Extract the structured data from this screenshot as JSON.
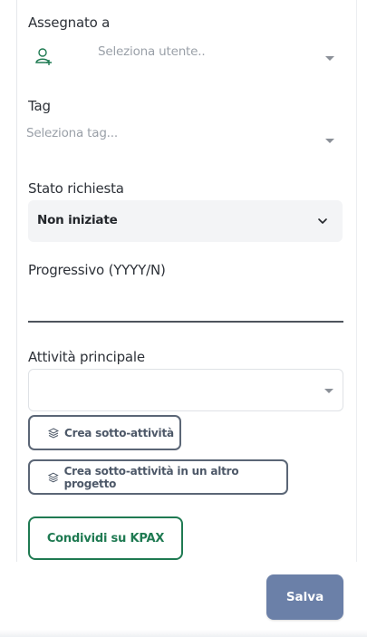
{
  "assigned": {
    "label": "Assegnato a",
    "placeholder": "Seleziona utente..",
    "icon": "add-user-icon"
  },
  "tag": {
    "label": "Tag",
    "placeholder": "Seleziona tag..."
  },
  "status": {
    "label": "Stato richiesta",
    "value": "Non iniziate"
  },
  "progressive": {
    "label": "Progressivo (YYYY/N)",
    "value": ""
  },
  "main_activity": {
    "label": "Attività principale",
    "value": ""
  },
  "buttons": {
    "create_subtask": "Crea sotto-attività",
    "create_subtask_other_project": "Crea sotto-attività in un altro progetto",
    "share_kpax": "Condividi su KPAX",
    "save": "Salva"
  },
  "colors": {
    "accent_green": "#1f7a52",
    "save_blue": "#6b80a8",
    "outline_slate": "#5b6676"
  }
}
